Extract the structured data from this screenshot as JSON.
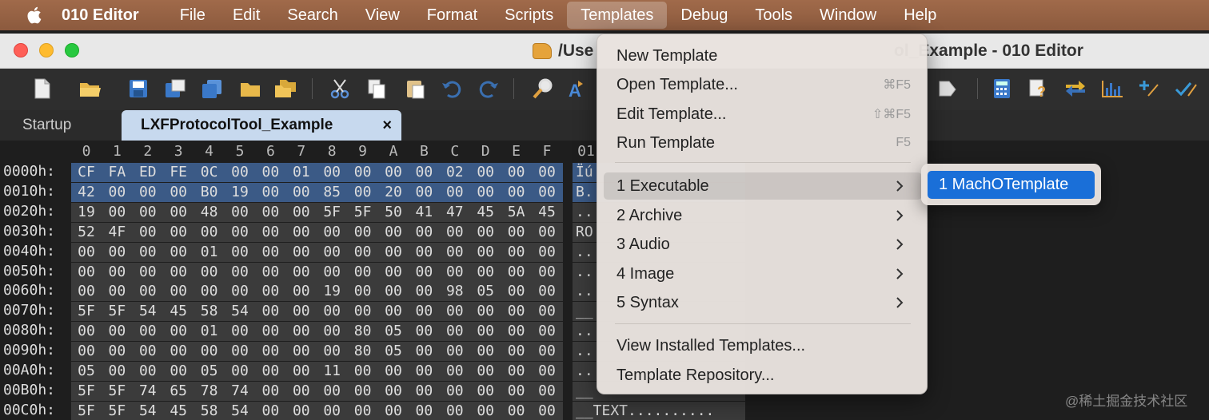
{
  "menubar": {
    "app": "010 Editor",
    "items": [
      "File",
      "Edit",
      "Search",
      "View",
      "Format",
      "Scripts",
      "Templates",
      "Debug",
      "Tools",
      "Window",
      "Help"
    ],
    "active": "Templates"
  },
  "window": {
    "title_left": "/Use",
    "title_right": "ol_Example - 010 Editor"
  },
  "toolbar": {
    "icons": [
      "new-file-icon",
      "open-folder-icon",
      "save-icon",
      "save-as-icon",
      "save-all-icon",
      "folder-icon",
      "workspace-icon",
      "cut-icon",
      "copy-icon",
      "paste-icon",
      "undo-icon",
      "redo-icon",
      "find-icon",
      "replace-icon",
      "bookmark-icon",
      "calculator-icon",
      "inspector-icon",
      "compare-icon",
      "histogram-icon",
      "add-bookmark-icon",
      "check-icon"
    ]
  },
  "tabs": {
    "startup": "Startup",
    "active": "LXFProtocolTool_Example",
    "close_glyph": "×"
  },
  "hex": {
    "columns": [
      "0",
      "1",
      "2",
      "3",
      "4",
      "5",
      "6",
      "7",
      "8",
      "9",
      "A",
      "B",
      "C",
      "D",
      "E",
      "F"
    ],
    "ascii_header": "01",
    "rows": [
      {
        "addr": "0000h:",
        "bytes": [
          "CF",
          "FA",
          "ED",
          "FE",
          "0C",
          "00",
          "00",
          "01",
          "00",
          "00",
          "00",
          "00",
          "02",
          "00",
          "00",
          "00"
        ],
        "ascii": "Ïú",
        "selected": true
      },
      {
        "addr": "0010h:",
        "bytes": [
          "42",
          "00",
          "00",
          "00",
          "B0",
          "19",
          "00",
          "00",
          "85",
          "00",
          "20",
          "00",
          "00",
          "00",
          "00",
          "00"
        ],
        "ascii": "B.",
        "selected": true
      },
      {
        "addr": "0020h:",
        "bytes": [
          "19",
          "00",
          "00",
          "00",
          "48",
          "00",
          "00",
          "00",
          "5F",
          "5F",
          "50",
          "41",
          "47",
          "45",
          "5A",
          "45"
        ],
        "ascii": "..",
        "selected": false
      },
      {
        "addr": "0030h:",
        "bytes": [
          "52",
          "4F",
          "00",
          "00",
          "00",
          "00",
          "00",
          "00",
          "00",
          "00",
          "00",
          "00",
          "00",
          "00",
          "00",
          "00"
        ],
        "ascii": "RO",
        "selected": false
      },
      {
        "addr": "0040h:",
        "bytes": [
          "00",
          "00",
          "00",
          "00",
          "01",
          "00",
          "00",
          "00",
          "00",
          "00",
          "00",
          "00",
          "00",
          "00",
          "00",
          "00"
        ],
        "ascii": "..",
        "selected": false
      },
      {
        "addr": "0050h:",
        "bytes": [
          "00",
          "00",
          "00",
          "00",
          "00",
          "00",
          "00",
          "00",
          "00",
          "00",
          "00",
          "00",
          "00",
          "00",
          "00",
          "00"
        ],
        "ascii": "..",
        "selected": false
      },
      {
        "addr": "0060h:",
        "bytes": [
          "00",
          "00",
          "00",
          "00",
          "00",
          "00",
          "00",
          "00",
          "19",
          "00",
          "00",
          "00",
          "98",
          "05",
          "00",
          "00"
        ],
        "ascii": "..",
        "selected": false
      },
      {
        "addr": "0070h:",
        "bytes": [
          "5F",
          "5F",
          "54",
          "45",
          "58",
          "54",
          "00",
          "00",
          "00",
          "00",
          "00",
          "00",
          "00",
          "00",
          "00",
          "00"
        ],
        "ascii": "__",
        "selected": false
      },
      {
        "addr": "0080h:",
        "bytes": [
          "00",
          "00",
          "00",
          "00",
          "01",
          "00",
          "00",
          "00",
          "00",
          "80",
          "05",
          "00",
          "00",
          "00",
          "00",
          "00"
        ],
        "ascii": "..",
        "selected": false
      },
      {
        "addr": "0090h:",
        "bytes": [
          "00",
          "00",
          "00",
          "00",
          "00",
          "00",
          "00",
          "00",
          "00",
          "80",
          "05",
          "00",
          "00",
          "00",
          "00",
          "00"
        ],
        "ascii": "..",
        "selected": false
      },
      {
        "addr": "00A0h:",
        "bytes": [
          "05",
          "00",
          "00",
          "00",
          "05",
          "00",
          "00",
          "00",
          "11",
          "00",
          "00",
          "00",
          "00",
          "00",
          "00",
          "00"
        ],
        "ascii": "..",
        "selected": false
      },
      {
        "addr": "00B0h:",
        "bytes": [
          "5F",
          "5F",
          "74",
          "65",
          "78",
          "74",
          "00",
          "00",
          "00",
          "00",
          "00",
          "00",
          "00",
          "00",
          "00",
          "00"
        ],
        "ascii": "__",
        "selected": false
      },
      {
        "addr": "00C0h:",
        "bytes": [
          "5F",
          "5F",
          "54",
          "45",
          "58",
          "54",
          "00",
          "00",
          "00",
          "00",
          "00",
          "00",
          "00",
          "00",
          "00",
          "00"
        ],
        "ascii": "__TEXT..........",
        "selected": false
      }
    ]
  },
  "dropdown": {
    "items": [
      {
        "label": "New Template",
        "shortcut": "",
        "submenu": false
      },
      {
        "label": "Open Template...",
        "shortcut": "⌘F5",
        "submenu": false
      },
      {
        "label": "Edit Template...",
        "shortcut": "⇧⌘F5",
        "submenu": false
      },
      {
        "label": "Run Template",
        "shortcut": "F5",
        "submenu": false
      },
      {
        "label": "1 Executable",
        "shortcut": "",
        "submenu": true
      },
      {
        "label": "2 Archive",
        "shortcut": "",
        "submenu": true
      },
      {
        "label": "3 Audio",
        "shortcut": "",
        "submenu": true
      },
      {
        "label": "4 Image",
        "shortcut": "",
        "submenu": true
      },
      {
        "label": "5 Syntax",
        "shortcut": "",
        "submenu": true
      },
      {
        "label": "View Installed Templates...",
        "shortcut": "",
        "submenu": false
      },
      {
        "label": "Template Repository...",
        "shortcut": "",
        "submenu": false
      }
    ],
    "hovered": "1 Executable"
  },
  "submenu": {
    "item": "1 MachOTemplate"
  },
  "watermark": "@稀土掘金技术社区",
  "colors": {
    "menubar": "#8c5a3e",
    "selection": "#3b5a86",
    "accent": "#1a6fd8",
    "tab_active": "#c7d9ee"
  }
}
